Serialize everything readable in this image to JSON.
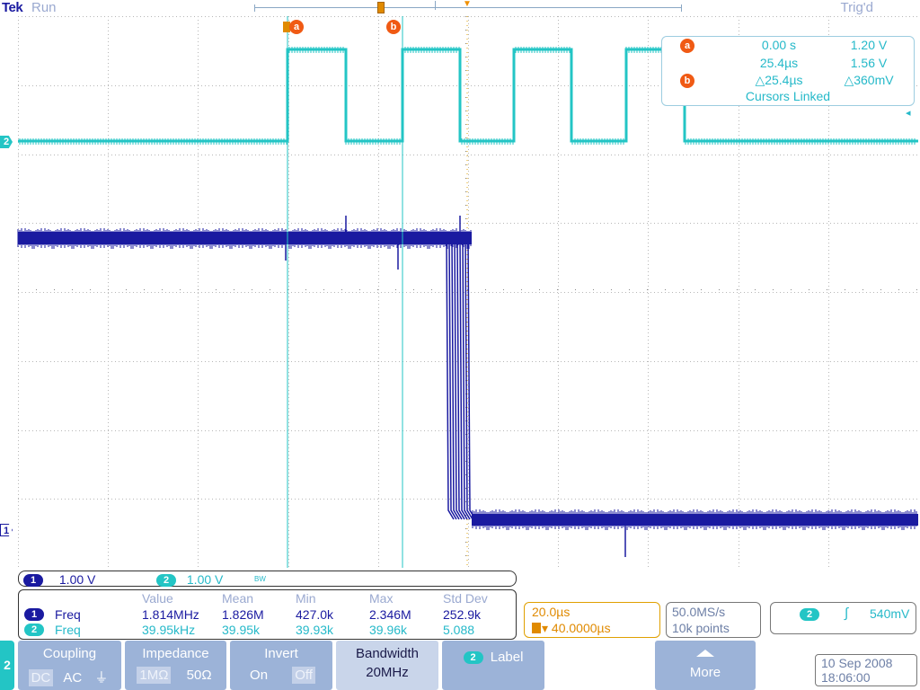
{
  "header": {
    "brand": "Tek",
    "run_state": "Run",
    "trigger_state": "Trig'd"
  },
  "channels": {
    "ch2_marker": "2",
    "ch1_marker": "1"
  },
  "cursors": {
    "a_flag": "a",
    "b_flag": "b",
    "a_time": "0.00 s",
    "a_volt": "1.20 V",
    "b_time": "25.4µs",
    "b_volt": "1.56 V",
    "delta_time": "△25.4µs",
    "delta_volt": "△360mV",
    "linked": "Cursors Linked"
  },
  "scale": {
    "ch1_num": "1",
    "ch1_value": "1.00 V",
    "ch2_num": "2",
    "ch2_value": "1.00 V",
    "ch2_bw_symbol": "BW"
  },
  "measurements": {
    "headers": [
      "Value",
      "Mean",
      "Min",
      "Max",
      "Std Dev"
    ],
    "rows": [
      {
        "ch": "1",
        "name": "Freq",
        "value": "1.814MHz",
        "mean": "1.826M",
        "min": "427.0k",
        "max": "2.346M",
        "std": "252.9k"
      },
      {
        "ch": "2",
        "name": "Freq",
        "value": "39.95kHz",
        "mean": "39.95k",
        "min": "39.93k",
        "max": "39.96k",
        "std": "5.088"
      }
    ]
  },
  "horizontal": {
    "scale": "20.0µs",
    "position": "▾ 40.0000µs"
  },
  "acquisition": {
    "rate": "50.0MS/s",
    "points": "10k points"
  },
  "trigger": {
    "source": "2",
    "slope": "∫",
    "level": "540mV"
  },
  "menu": {
    "channel": "2",
    "coupling": {
      "title": "Coupling",
      "options": [
        "DC",
        "AC",
        "⏚"
      ]
    },
    "impedance": {
      "title": "Impedance",
      "options": [
        "1MΩ",
        "50Ω"
      ]
    },
    "invert": {
      "title": "Invert",
      "options": [
        "On",
        "Off"
      ]
    },
    "bandwidth": {
      "title": "Bandwidth",
      "value": "20MHz"
    },
    "label": {
      "num": "2",
      "title": "Label"
    },
    "more": {
      "title": "More"
    }
  },
  "datetime": {
    "date": "10 Sep  2008",
    "time": "18:06:00"
  },
  "colors": {
    "ch1": "#1a1aa0",
    "ch2": "#23c5c5",
    "cursor_flag": "#f05a14",
    "horizontal": "#e08a00"
  }
}
